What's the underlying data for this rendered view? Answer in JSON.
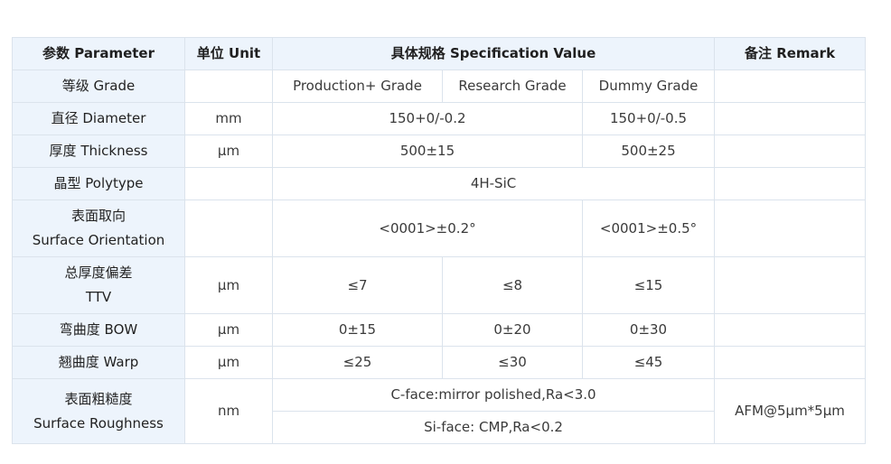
{
  "header": {
    "parameter": "参数 Parameter",
    "unit": "单位 Unit",
    "spec": "具体规格 Specification Value",
    "remark": "备注 Remark"
  },
  "rows": {
    "grade": {
      "label": "等级 Grade",
      "unit": "",
      "production": "Production+ Grade",
      "research": "Research Grade",
      "dummy": "Dummy Grade"
    },
    "diameter": {
      "label": "直径 Diameter",
      "unit": "mm",
      "prod_research": "150+0/-0.2",
      "dummy": "150+0/-0.5"
    },
    "thickness": {
      "label": "厚度 Thickness",
      "unit": "μm",
      "prod_research": "500±15",
      "dummy": "500±25"
    },
    "polytype": {
      "label": "晶型 Polytype",
      "unit": "",
      "value": "4H-SiC"
    },
    "orientation": {
      "label_line1": "表面取向",
      "label_line2": "Surface Orientation",
      "unit": "",
      "prod_research": "<0001>±0.2°",
      "dummy": "<0001>±0.5°"
    },
    "ttv": {
      "label_line1": "总厚度偏差",
      "label_line2": "TTV",
      "unit": "μm",
      "production": "≤7",
      "research": "≤8",
      "dummy": "≤15"
    },
    "bow": {
      "label": "弯曲度 BOW",
      "unit": "μm",
      "production": "0±15",
      "research": "0±20",
      "dummy": "0±30"
    },
    "warp": {
      "label": "翘曲度 Warp",
      "unit": "μm",
      "production": "≤25",
      "research": "≤30",
      "dummy": "≤45"
    },
    "roughness": {
      "label_line1": "表面粗糙度",
      "label_line2": "Surface Roughness",
      "unit": "nm",
      "cface": "C-face:mirror polished,Ra<3.0",
      "siface": "Si-face: CMP,Ra<0.2",
      "remark": "AFM@5μm*5μm"
    }
  },
  "colors": {
    "header_bg": "#edf4fc",
    "border": "#dbe3ec",
    "text": "#3a3a3a"
  }
}
